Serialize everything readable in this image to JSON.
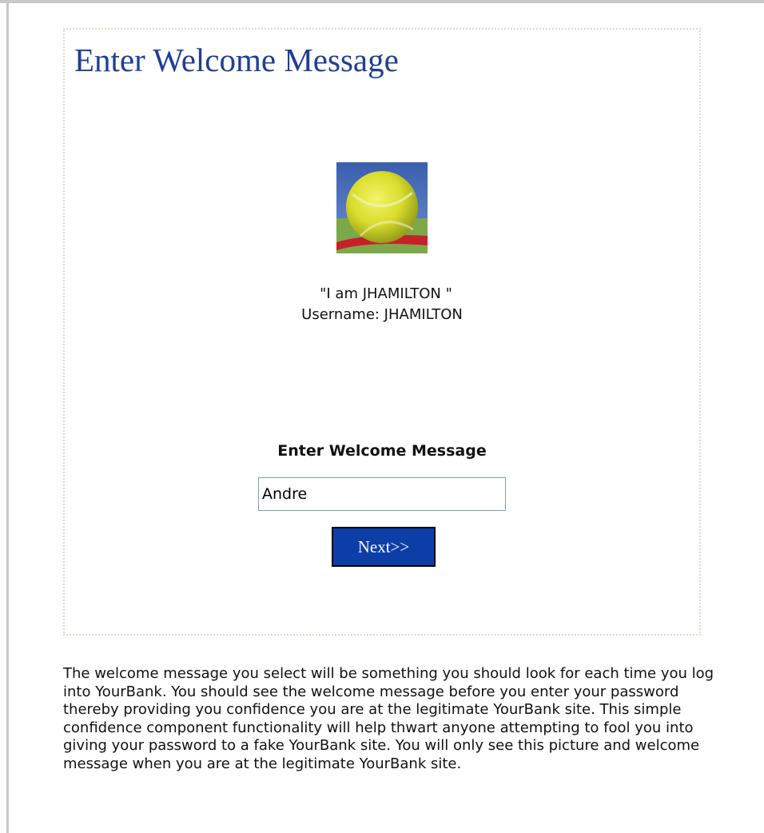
{
  "panel": {
    "title": "Enter Welcome Message",
    "picture_icon": "tennis-ball-image",
    "welcome_quote": "\"I am JHAMILTON \"",
    "username_line": "Username: JHAMILTON",
    "form_label": "Enter Welcome Message",
    "input_value": "Andre",
    "next_label": "Next>>"
  },
  "description": "The welcome message you select will be something you should look for each time you log into YourBank. You should see the welcome message before you enter your password thereby providing you confidence you are at the legitimate YourBank site. This simple confidence component functionality will help thwart anyone attempting to fool you into giving your password to a fake YourBank site. You will only see this picture and welcome message when you are at the legitimate YourBank site.",
  "colors": {
    "title": "#1f3f95",
    "button_bg": "#0d3ea8",
    "panel_border": "#dcdccc",
    "frame": "#c8c8c8"
  }
}
